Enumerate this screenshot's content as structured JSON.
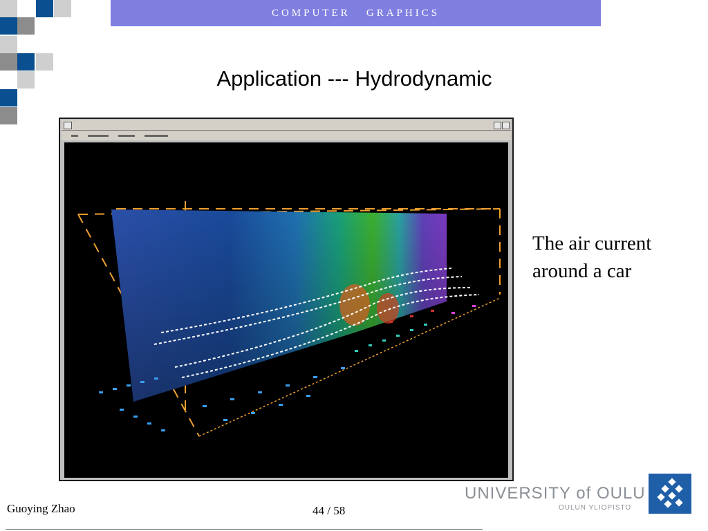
{
  "header": {
    "course_title": "COMPUTER   GRAPHICS"
  },
  "slide": {
    "title": "Application --- Hydrodynamic",
    "caption_line1": "The air current",
    "caption_line2": "around a car"
  },
  "footer": {
    "author": "Guoying Zhao",
    "page_current": "44",
    "page_separator": "/",
    "page_total": "58",
    "university_name": "UNIVERSITY of OULU",
    "university_subname": "OULUN YLIOPISTO"
  },
  "colors": {
    "header_bar": "#7f7fe0",
    "checker_dark_blue": "#0a4f8f",
    "checker_gray": "#8c8c8c",
    "checker_light_gray": "#cfcfcf",
    "university_text": "#8a8f96",
    "logo_blue": "#1f5fa8"
  },
  "icons": {
    "figure_window": [
      "window-menu-icon",
      "minimize-icon",
      "maximize-icon"
    ],
    "logo": "university-emblem-icon"
  }
}
